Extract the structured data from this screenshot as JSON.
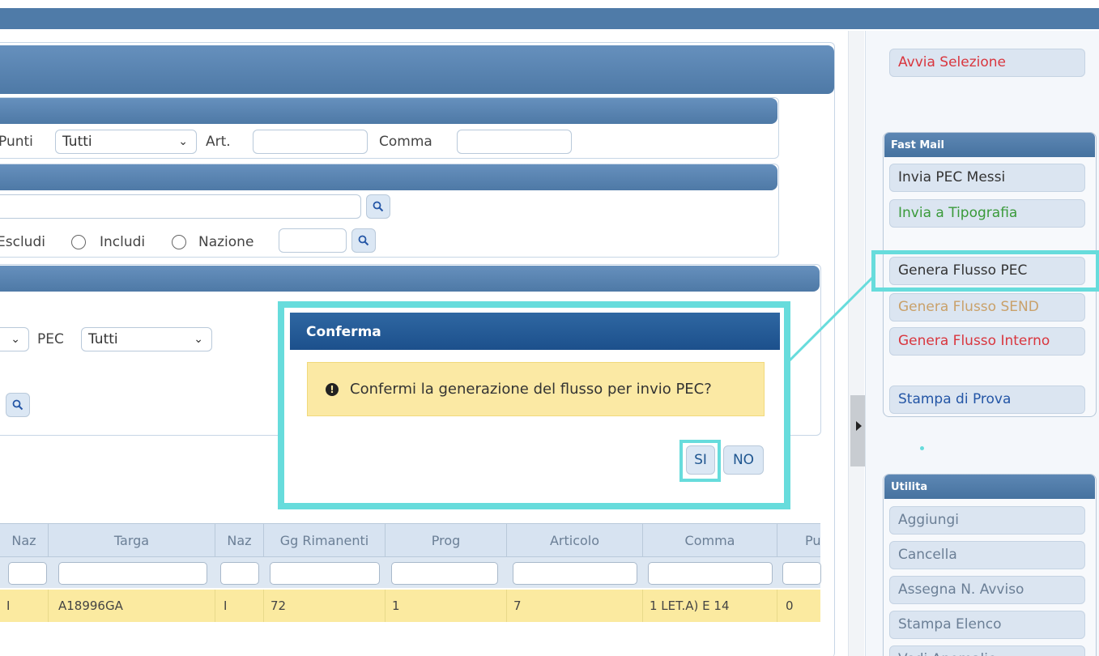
{
  "filters": {
    "punti_label": "Punti",
    "punti_value": "Tutti",
    "art_label": "Art.",
    "comma_label": "Comma",
    "escludi_label": "Escludi",
    "includi_label": "Includi",
    "nazione_label": "Nazione",
    "pec_label": "PEC",
    "pec_value": "Tutti"
  },
  "table": {
    "headers": [
      "Naz",
      "Targa",
      "Naz",
      "Gg Rimanenti",
      "Prog",
      "Articolo",
      "Comma",
      "Pu"
    ],
    "row": [
      "I",
      "A18996GA",
      "I",
      "72",
      "1",
      "7",
      "1 LET.A) E 14",
      "0"
    ]
  },
  "dialog": {
    "title": "Conferma",
    "message": "Confermi la generazione del flusso per invio PEC?",
    "yes_label": "SI",
    "no_label": "NO"
  },
  "sidebar": {
    "avvia_selezione": "Avvia Selezione",
    "fast_mail_title": "Fast Mail",
    "fast_mail_items": [
      {
        "label": "Invia PEC Messi",
        "color": "#333333"
      },
      {
        "label": "Invia a Tipografia",
        "color": "#3a9a3a"
      },
      {
        "label": "Genera Flusso PEC",
        "color": "#333333"
      },
      {
        "label": "Genera Flusso SEND",
        "color": "#c9a16a"
      },
      {
        "label": "Genera Flusso Interno",
        "color": "#d9363e"
      },
      {
        "label": "Stampa di Prova",
        "color": "#2456a6"
      }
    ],
    "utilita_title": "Utilita",
    "utilita_items": [
      "Aggiungi",
      "Cancella",
      "Assegna N. Avviso",
      "Stampa Elenco",
      "Vedi Anomalie"
    ]
  },
  "colors": {
    "accent_highlight": "#67dcdc",
    "header_blue": "#1c508c",
    "avvia_red": "#d9363e"
  }
}
